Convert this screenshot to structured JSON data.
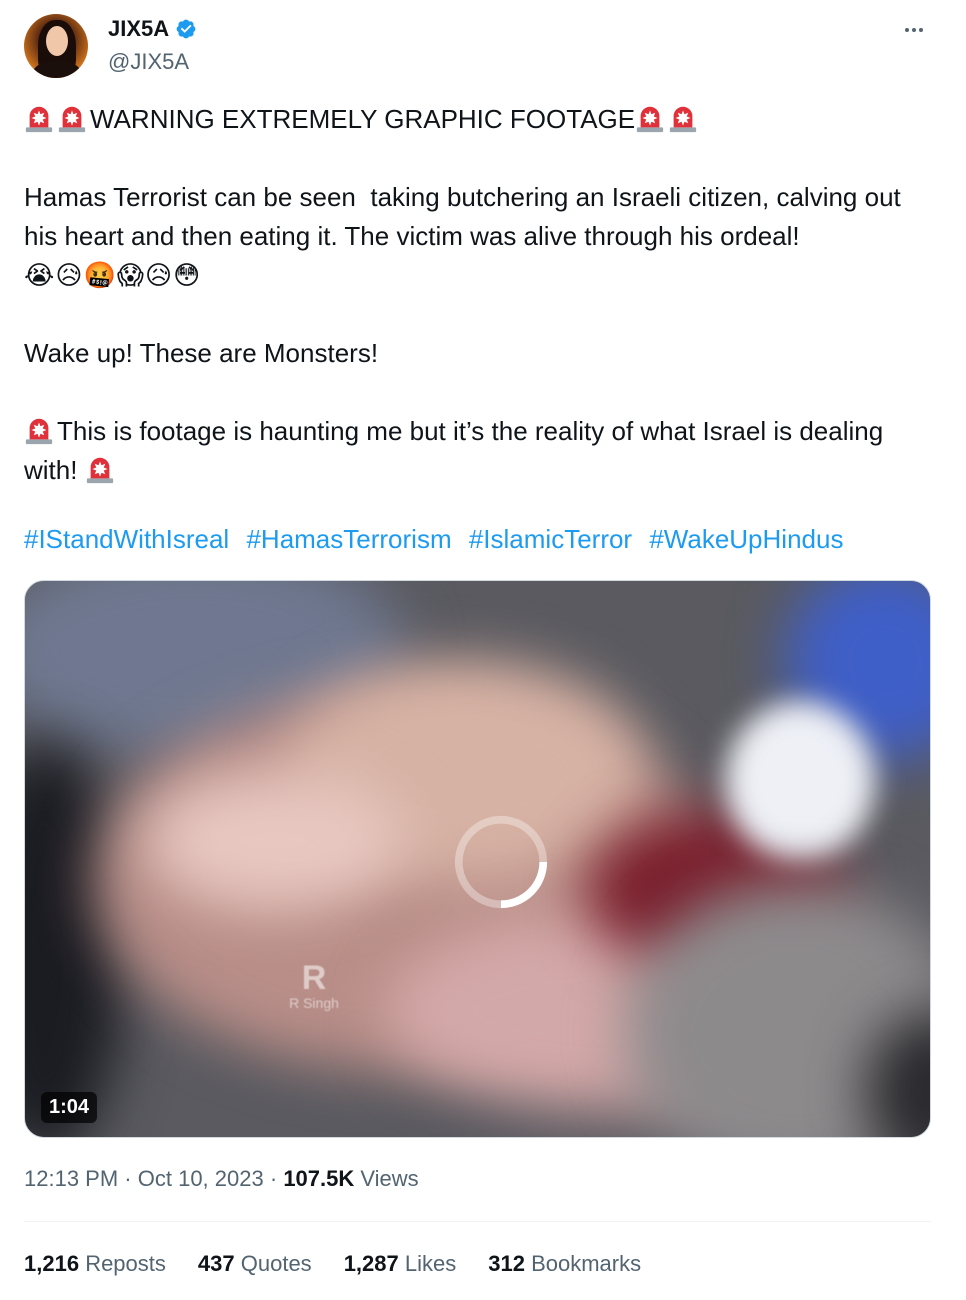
{
  "author": {
    "display_name": "JIX5A",
    "handle": "@JIX5A",
    "verified": true
  },
  "tweet": {
    "warning_line": "WARNING EXTREMELY GRAPHIC FOOTAGE",
    "paragraph1": "Hamas Terrorist can be seen  taking butchering an Israeli citizen, calving out his heart and then eating it. The victim was alive through his ordeal!",
    "emoji_line": "😭😥🤬😱😥😳",
    "paragraph2": "Wake up! These are Monsters!",
    "paragraph3": "This is footage is haunting me but it’s the reality of what Israel is dealing with!",
    "hashtags": [
      "#IStandWithIsreal",
      "#HamasTerrorism",
      "#IslamicTerror",
      "#WakeUpHindus"
    ]
  },
  "video": {
    "duration": "1:04",
    "watermark_text": "R Singh",
    "watermark_logo": "R"
  },
  "meta": {
    "time": "12:13 PM",
    "date": "Oct 10, 2023",
    "views_count": "107.5K",
    "views_label": "Views"
  },
  "stats": {
    "reposts_count": "1,216",
    "reposts_label": "Reposts",
    "quotes_count": "437",
    "quotes_label": "Quotes",
    "likes_count": "1,287",
    "likes_label": "Likes",
    "bookmarks_count": "312",
    "bookmarks_label": "Bookmarks"
  },
  "colors": {
    "link": "#1d9bf0",
    "secondary_text": "#536471",
    "primary_text": "#0f1419",
    "verified_badge": "#1d9bf0",
    "siren_red": "#e0313a"
  },
  "icons": [
    "avatar",
    "verified-badge-icon",
    "more-icon",
    "police-siren-icon",
    "loading-spinner-icon"
  ]
}
